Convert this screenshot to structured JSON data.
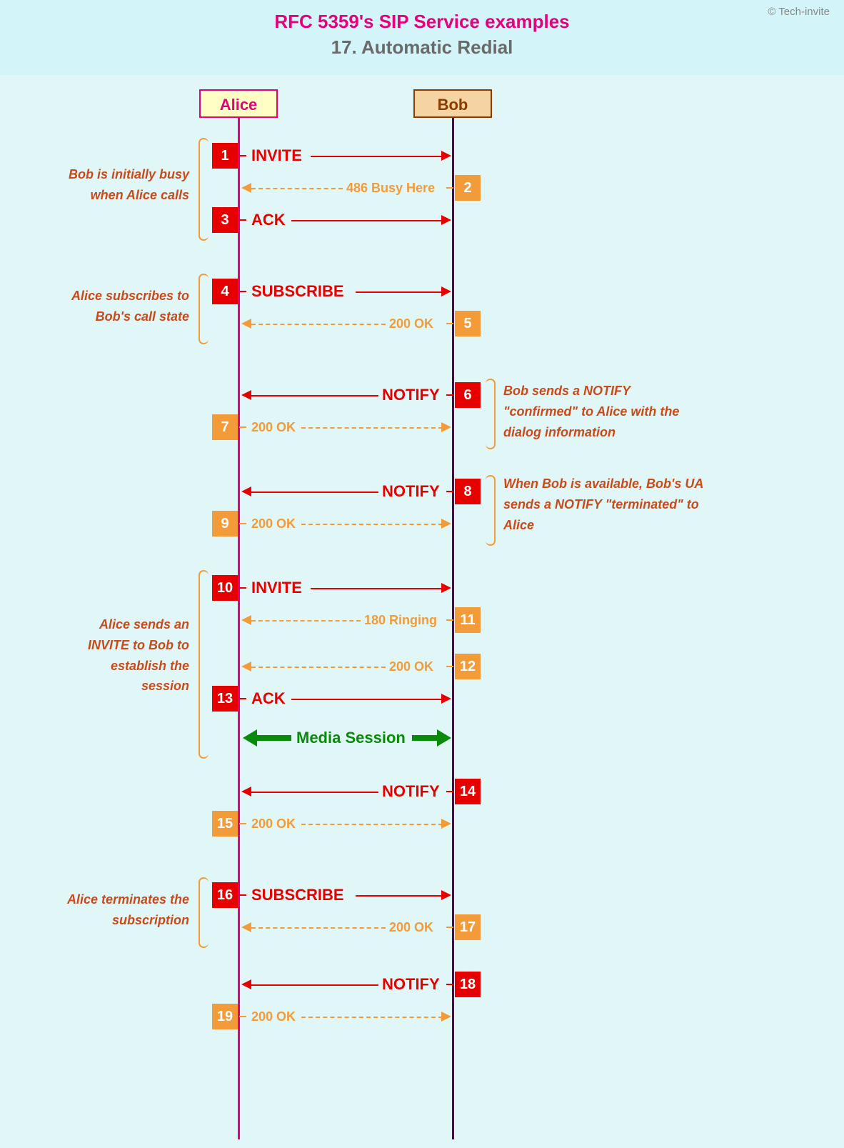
{
  "header": {
    "title1": "RFC 5359's SIP Service examples",
    "title2": "17. Automatic Redial",
    "copyright": "© Tech-invite"
  },
  "actors": {
    "alice": "Alice",
    "bob": "Bob"
  },
  "media_session": "Media Session",
  "steps": {
    "s1": {
      "n": "1",
      "label": "INVITE"
    },
    "s2": {
      "n": "2",
      "label": "486 Busy Here"
    },
    "s3": {
      "n": "3",
      "label": "ACK"
    },
    "s4": {
      "n": "4",
      "label": "SUBSCRIBE"
    },
    "s5": {
      "n": "5",
      "label": "200 OK"
    },
    "s6": {
      "n": "6",
      "label": "NOTIFY"
    },
    "s7": {
      "n": "7",
      "label": "200 OK"
    },
    "s8": {
      "n": "8",
      "label": "NOTIFY"
    },
    "s9": {
      "n": "9",
      "label": "200 OK"
    },
    "s10": {
      "n": "10",
      "label": "INVITE"
    },
    "s11": {
      "n": "11",
      "label": "180 Ringing"
    },
    "s12": {
      "n": "12",
      "label": "200 OK"
    },
    "s13": {
      "n": "13",
      "label": "ACK"
    },
    "s14": {
      "n": "14",
      "label": "NOTIFY"
    },
    "s15": {
      "n": "15",
      "label": "200 OK"
    },
    "s16": {
      "n": "16",
      "label": "SUBSCRIBE"
    },
    "s17": {
      "n": "17",
      "label": "200 OK"
    },
    "s18": {
      "n": "18",
      "label": "NOTIFY"
    },
    "s19": {
      "n": "19",
      "label": "200 OK"
    }
  },
  "notes": {
    "n1": "Bob is initially busy when Alice calls",
    "n2": "Alice subscribes to Bob's call state",
    "n3": "Bob sends a NOTIFY \"confirmed\" to Alice with the dialog information",
    "n4": "When Bob is available, Bob's UA sends a NOTIFY \"terminated\" to Alice",
    "n5": "Alice sends an INVITE to Bob to establish the session",
    "n6": "Alice terminates the subscription"
  }
}
